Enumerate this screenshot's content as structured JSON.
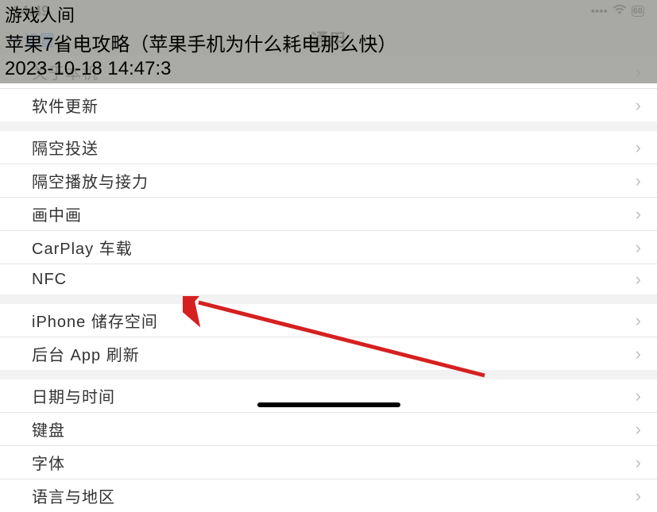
{
  "status": {
    "time": "14:49",
    "signal": "▪▪▪▪",
    "wifi": "⬿",
    "battery": "68"
  },
  "nav": {
    "back_label": "设置",
    "title": "通用"
  },
  "overlay": {
    "site": "游戏人间",
    "title": "苹果7省电攻略（苹果手机为什么耗电那么快）",
    "date": "2023-10-18 14:47:3"
  },
  "groups": [
    {
      "items": [
        {
          "label": "关于本机"
        },
        {
          "label": "软件更新"
        }
      ]
    },
    {
      "items": [
        {
          "label": "隔空投送"
        },
        {
          "label": "隔空播放与接力"
        },
        {
          "label": "画中画"
        },
        {
          "label": "CarPlay 车载"
        },
        {
          "label": "NFC"
        }
      ]
    },
    {
      "items": [
        {
          "label": "iPhone 储存空间"
        },
        {
          "label": "后台 App 刷新"
        }
      ]
    },
    {
      "items": [
        {
          "label": "日期与时间"
        },
        {
          "label": "键盘"
        },
        {
          "label": "字体"
        },
        {
          "label": "语言与地区"
        }
      ]
    }
  ]
}
